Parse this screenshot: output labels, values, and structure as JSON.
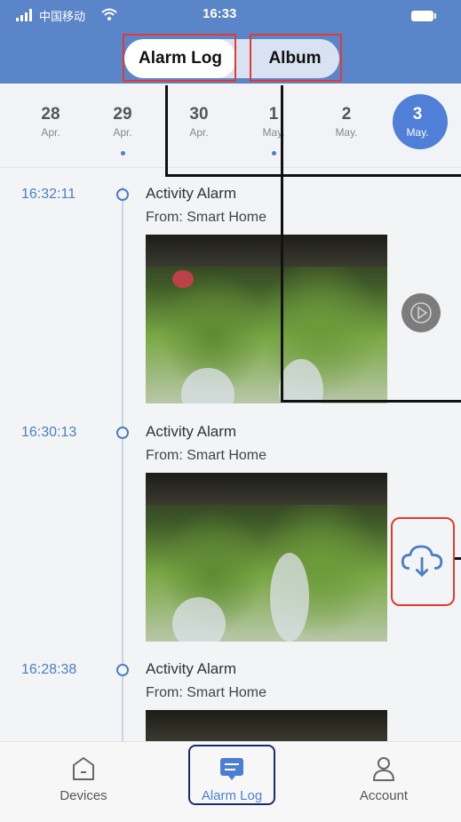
{
  "status_bar": {
    "carrier": "中国移动",
    "time": "16:33"
  },
  "tabs": [
    {
      "label": "Alarm Log",
      "active": true
    },
    {
      "label": "Album",
      "active": false
    }
  ],
  "dates": [
    {
      "day": "28",
      "month": "Apr.",
      "has_events": false,
      "selected": false
    },
    {
      "day": "29",
      "month": "Apr.",
      "has_events": true,
      "selected": false
    },
    {
      "day": "30",
      "month": "Apr.",
      "has_events": false,
      "selected": false
    },
    {
      "day": "1",
      "month": "May.",
      "has_events": true,
      "selected": false
    },
    {
      "day": "2",
      "month": "May.",
      "has_events": false,
      "selected": false
    },
    {
      "day": "3",
      "month": "May.",
      "has_events": false,
      "selected": true
    }
  ],
  "events": [
    {
      "time": "16:32:11",
      "title": "Activity Alarm",
      "source": "From: Smart Home"
    },
    {
      "time": "16:30:13",
      "title": "Activity Alarm",
      "source": "From: Smart Home"
    },
    {
      "time": "16:28:38",
      "title": "Activity Alarm",
      "source": "From: Smart Home"
    }
  ],
  "bottom_nav": [
    {
      "label": "Devices",
      "icon": "devices-icon",
      "active": false
    },
    {
      "label": "Alarm Log",
      "icon": "alarm-log-icon",
      "active": true
    },
    {
      "label": "Account",
      "icon": "account-icon",
      "active": false
    }
  ],
  "colors": {
    "header": "#5b85c9",
    "accent": "#4f7fd6",
    "highlight": "#e23b2e"
  }
}
